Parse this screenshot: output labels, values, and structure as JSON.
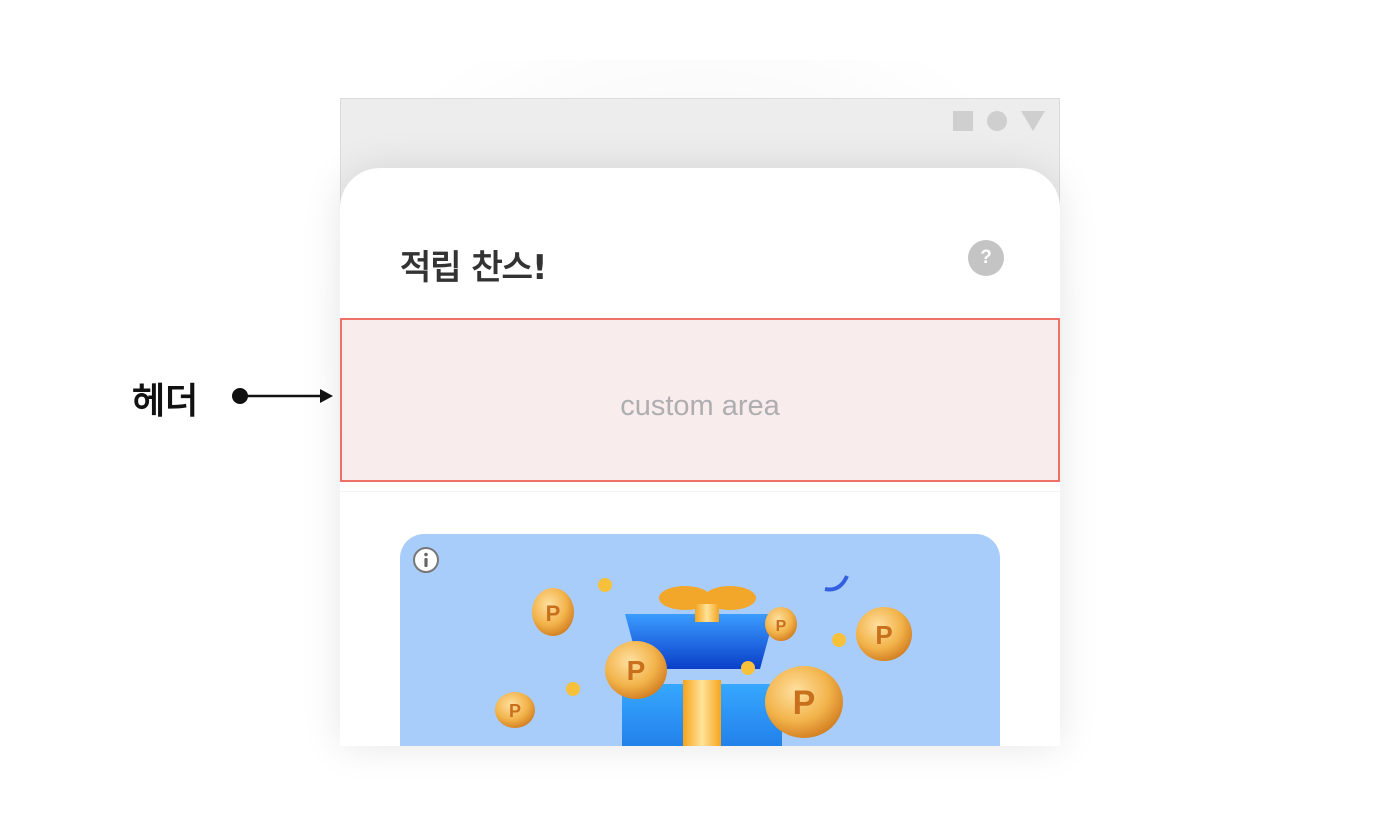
{
  "annotation": {
    "label": "헤더"
  },
  "window": {
    "status_icons": [
      "square-icon",
      "circle-icon",
      "triangle-icon"
    ]
  },
  "sheet": {
    "title": "적립 찬스!",
    "help_label": "?",
    "custom_area_label": "custom area"
  },
  "banner": {
    "info_icon": "info-icon",
    "coin_letter": "P"
  },
  "colors": {
    "highlight_border": "#ee7066",
    "highlight_fill": "#f9eced",
    "banner_bg": "#a8cdfb",
    "coin": "#f2b34a",
    "gift_box": "#2a8cf0"
  }
}
